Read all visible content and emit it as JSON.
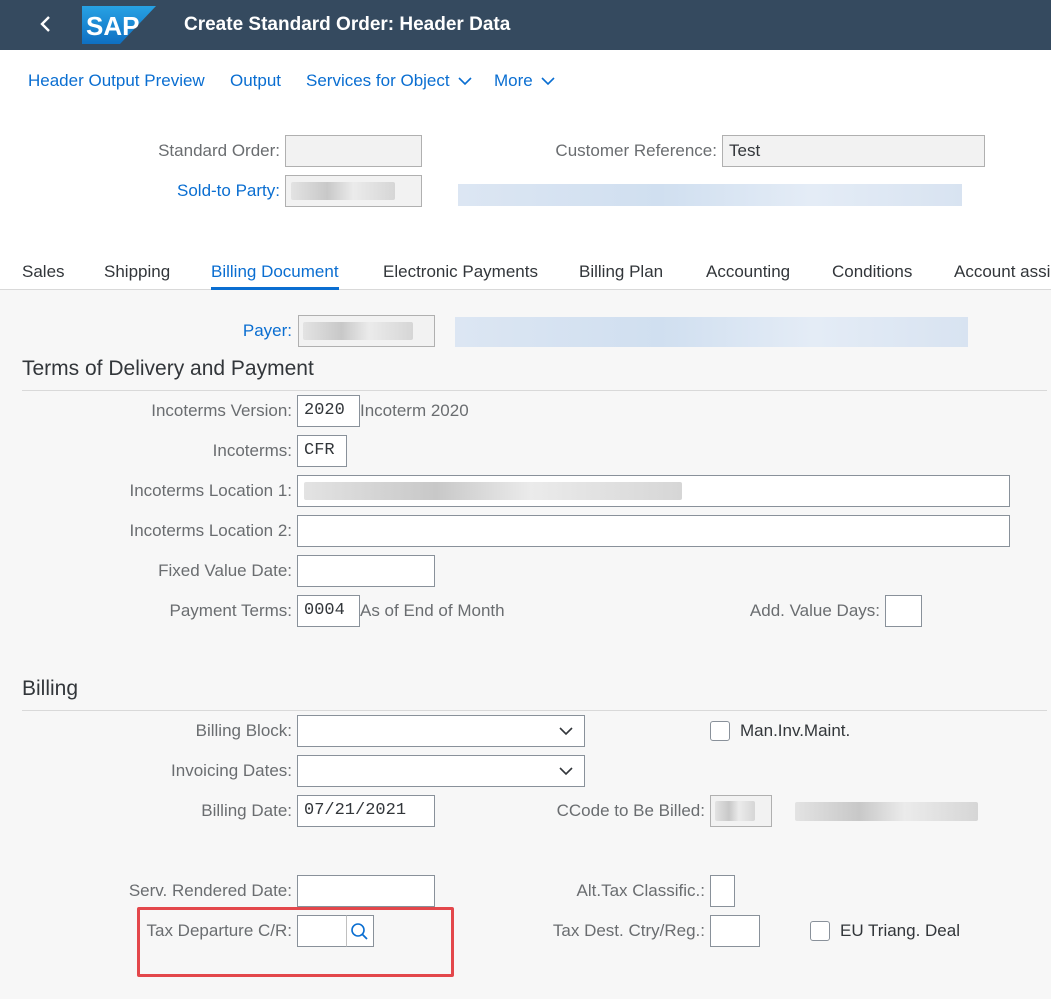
{
  "header": {
    "title": "Create Standard Order: Header Data",
    "logo_text": "SAP"
  },
  "toolbar": {
    "header_output_preview": "Header Output Preview",
    "output": "Output",
    "services_for_object": "Services for Object",
    "more": "More"
  },
  "order_header": {
    "standard_order_label": "Standard Order:",
    "standard_order_value": "",
    "customer_reference_label": "Customer Reference:",
    "customer_reference_value": "Test",
    "sold_to_party_label": "Sold-to Party:"
  },
  "tabs": [
    {
      "label": "Sales"
    },
    {
      "label": "Shipping"
    },
    {
      "label": "Billing Document",
      "active": true
    },
    {
      "label": "Electronic Payments"
    },
    {
      "label": "Billing Plan"
    },
    {
      "label": "Accounting"
    },
    {
      "label": "Conditions"
    },
    {
      "label": "Account assi"
    }
  ],
  "payer": {
    "label": "Payer:"
  },
  "terms": {
    "section_title": "Terms of Delivery and Payment",
    "incoterms_version_label": "Incoterms Version:",
    "incoterms_version_value": "2020",
    "incoterms_version_text": "Incoterm 2020",
    "incoterms_label": "Incoterms:",
    "incoterms_value": "CFR",
    "incoterms_location1_label": "Incoterms Location 1:",
    "incoterms_location2_label": "Incoterms Location 2:",
    "incoterms_location2_value": "",
    "fixed_value_date_label": "Fixed Value Date:",
    "fixed_value_date_value": "",
    "payment_terms_label": "Payment Terms:",
    "payment_terms_value": "0004",
    "payment_terms_text": "As of End of Month",
    "add_value_days_label": "Add. Value Days:",
    "add_value_days_value": ""
  },
  "billing": {
    "section_title": "Billing",
    "billing_block_label": "Billing Block:",
    "billing_block_value": "",
    "man_inv_maint_label": "Man.Inv.Maint.",
    "invoicing_dates_label": "Invoicing Dates:",
    "invoicing_dates_value": "",
    "billing_date_label": "Billing Date:",
    "billing_date_value": "07/21/2021",
    "ccode_to_be_billed_label": "CCode to Be Billed:",
    "serv_rendered_date_label": "Serv. Rendered Date:",
    "serv_rendered_date_value": "",
    "alt_tax_classific_label": "Alt.Tax Classific.:",
    "alt_tax_classific_value": "",
    "tax_departure_label": "Tax Departure C/R:",
    "tax_departure_value": "",
    "tax_dest_label": "Tax Dest. Ctry/Reg.:",
    "tax_dest_value": "",
    "eu_triang_label": "EU Triang. Deal"
  },
  "colors": {
    "shell": "#354a5f",
    "link": "#0a6ed1",
    "highlight": "#e3474b",
    "sap_logo": "#1a8fd6"
  },
  "icons": [
    "back-arrow-icon",
    "sap-logo",
    "chevron-down-icon",
    "search-icon"
  ]
}
